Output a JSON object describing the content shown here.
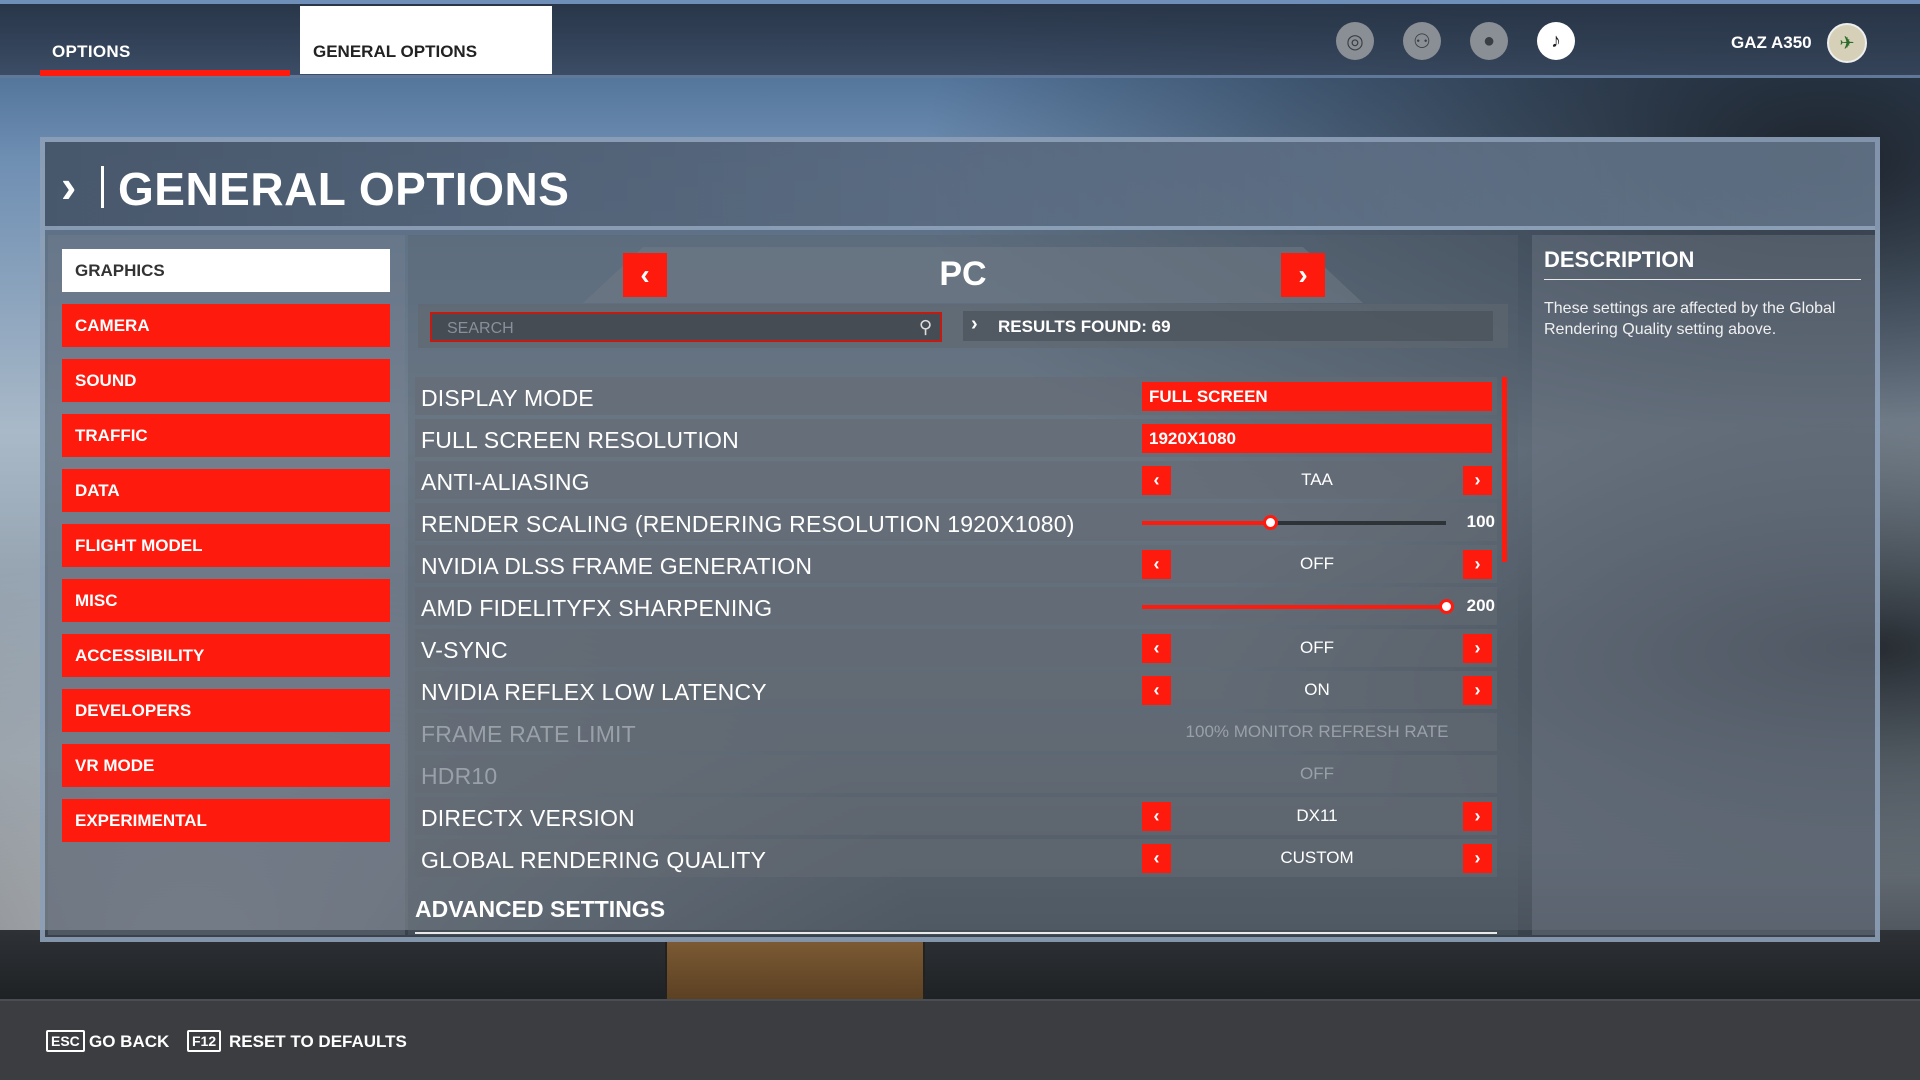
{
  "top_tabs": {
    "options": "OPTIONS",
    "general_options": "GENERAL OPTIONS"
  },
  "user": {
    "name": "GAZ A350"
  },
  "top_icons": [
    "activity-icon",
    "friends-icon",
    "profile-icon",
    "notification-icon"
  ],
  "header": {
    "title": "GENERAL OPTIONS"
  },
  "menu": {
    "items": [
      {
        "label": "GRAPHICS",
        "active": true
      },
      {
        "label": "CAMERA"
      },
      {
        "label": "SOUND"
      },
      {
        "label": "TRAFFIC"
      },
      {
        "label": "DATA"
      },
      {
        "label": "FLIGHT MODEL"
      },
      {
        "label": "MISC"
      },
      {
        "label": "ACCESSIBILITY"
      },
      {
        "label": "DEVELOPERS"
      },
      {
        "label": "VR MODE"
      },
      {
        "label": "EXPERIMENTAL"
      }
    ]
  },
  "platform": {
    "label": "PC",
    "prev": "‹",
    "next": "›"
  },
  "search": {
    "placeholder": "SEARCH",
    "results": "RESULTS FOUND: 69"
  },
  "settings": [
    {
      "label": "DISPLAY MODE",
      "type": "box",
      "value": "FULL SCREEN"
    },
    {
      "label": "FULL SCREEN RESOLUTION",
      "type": "box",
      "value": "1920X1080"
    },
    {
      "label": "ANTI-ALIASING",
      "type": "select",
      "value": "TAA"
    },
    {
      "label": "RENDER SCALING (RENDERING RESOLUTION 1920X1080)",
      "type": "slider",
      "value": "100",
      "fraction": 0.42
    },
    {
      "label": "NVIDIA DLSS FRAME GENERATION",
      "type": "select",
      "value": "OFF"
    },
    {
      "label": "AMD FIDELITYFX SHARPENING",
      "type": "slider",
      "value": "200",
      "fraction": 1.0
    },
    {
      "label": "V-SYNC",
      "type": "select",
      "value": "OFF"
    },
    {
      "label": "NVIDIA REFLEX LOW LATENCY",
      "type": "select",
      "value": "ON"
    },
    {
      "label": "FRAME RATE LIMIT",
      "type": "disabled",
      "value": "100% MONITOR REFRESH RATE"
    },
    {
      "label": "HDR10",
      "type": "disabled",
      "value": "OFF"
    },
    {
      "label": "DIRECTX VERSION",
      "type": "select",
      "value": "DX11"
    },
    {
      "label": "GLOBAL RENDERING QUALITY",
      "type": "select",
      "value": "CUSTOM"
    }
  ],
  "advanced": {
    "title": "ADVANCED SETTINGS"
  },
  "description": {
    "title": "DESCRIPTION",
    "text": "These settings are affected by the Global Rendering Quality setting above."
  },
  "footer": {
    "back_key": "ESC",
    "back_label": "GO BACK",
    "reset_key": "F12",
    "reset_label": "RESET TO DEFAULTS"
  },
  "colors": {
    "accent": "#ff1a0e",
    "active_menu_bg": "#ffffff"
  }
}
